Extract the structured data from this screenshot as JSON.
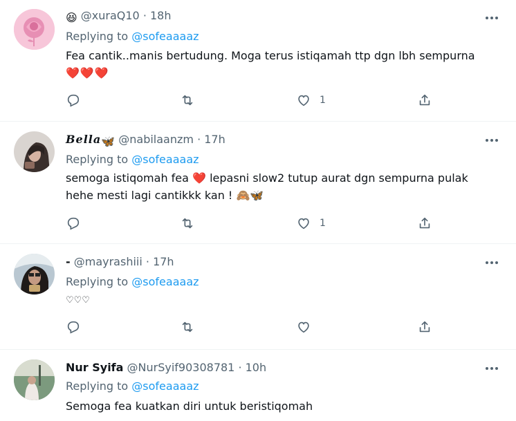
{
  "tweets": [
    {
      "name": "",
      "name_emoji": "😆",
      "handle": "@xuraQ10",
      "time": "18h",
      "replying_label": "Replying to",
      "replying_to": "@sofeaaaaz",
      "text_line1": "Fea cantik..manis bertudung. Moga terus istiqamah ttp dgn lbh sempurna",
      "text_line2": "❤️❤️❤️",
      "likes": "1"
    },
    {
      "name": "𝑩𝒆𝒍𝒍𝒂",
      "name_emoji": "🦋",
      "handle": "@nabilaanzm",
      "time": "17h",
      "replying_label": "Replying to",
      "replying_to": "@sofeaaaaz",
      "text_line1a": "semoga istiqomah fea",
      "text_line1_emoji": "❤️",
      "text_line1b": "lepasni slow2 tutup aurat dgn sempurna pulak",
      "text_line2": "hehe mesti lagi cantikkk kan !",
      "text_line2_emoji": "🙈🦋",
      "likes": "1"
    },
    {
      "name": "-",
      "handle": "@mayrashiii",
      "time": "17h",
      "replying_label": "Replying to",
      "replying_to": "@sofeaaaaz",
      "text_line1": "♡♡♡",
      "likes": ""
    },
    {
      "name": "Nur Syifa",
      "handle": "@NurSyif90308781",
      "time": "10h",
      "replying_label": "Replying to",
      "replying_to": "@sofeaaaaz",
      "text_line1": "Semoga fea kuatkan diri untuk beristiqomah"
    }
  ],
  "icons": {
    "reply": "reply-icon",
    "retweet": "retweet-icon",
    "like": "like-icon",
    "share": "share-icon",
    "more": "more-icon"
  },
  "colors": {
    "link": "#1d9bf0",
    "secondary": "#536471",
    "heart": "#e0245e"
  }
}
